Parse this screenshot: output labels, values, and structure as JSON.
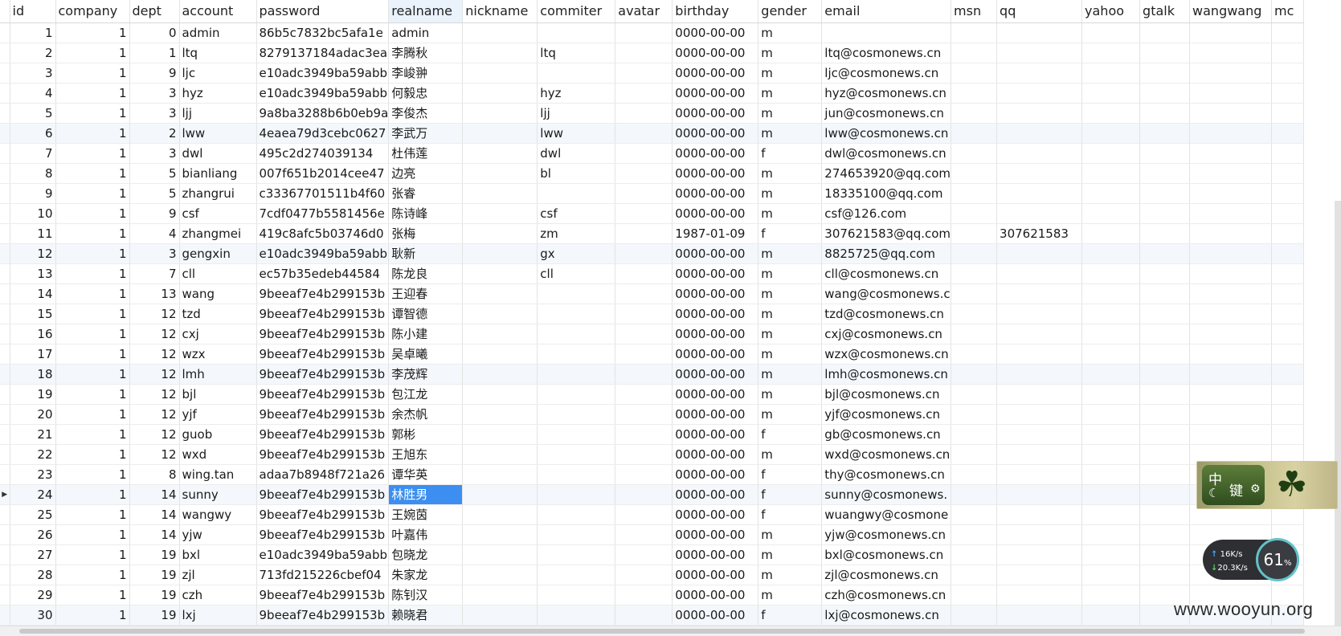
{
  "columns": [
    "id",
    "company",
    "dept",
    "account",
    "password",
    "realname",
    "nickname",
    "commiter",
    "avatar",
    "birthday",
    "gender",
    "email",
    "msn",
    "qq",
    "yahoo",
    "gtalk",
    "wangwang",
    "mc"
  ],
  "rows": [
    [
      "1",
      "1",
      "0",
      "admin",
      "86b5c7832bc5afa1e",
      "admin",
      "",
      "",
      "",
      "0000-00-00",
      "m",
      "",
      "",
      "",
      "",
      "",
      "",
      ""
    ],
    [
      "2",
      "1",
      "1",
      "ltq",
      "8279137184adac3ea",
      "李腾秋",
      "",
      "ltq",
      "",
      "0000-00-00",
      "m",
      "ltq@cosmonews.cn",
      "",
      "",
      "",
      "",
      "",
      ""
    ],
    [
      "3",
      "1",
      "9",
      "ljc",
      "e10adc3949ba59abb",
      "李峻翀",
      "",
      "",
      "",
      "0000-00-00",
      "m",
      "ljc@cosmonews.cn",
      "",
      "",
      "",
      "",
      "",
      ""
    ],
    [
      "4",
      "1",
      "3",
      "hyz",
      "e10adc3949ba59abb",
      "何毅忠",
      "",
      "hyz",
      "",
      "0000-00-00",
      "m",
      "hyz@cosmonews.cn",
      "",
      "",
      "",
      "",
      "",
      ""
    ],
    [
      "5",
      "1",
      "3",
      "ljj",
      "9a8ba3288b6b0eb9a",
      "李俊杰",
      "",
      "ljj",
      "",
      "0000-00-00",
      "m",
      "jun@cosmonews.cn",
      "",
      "",
      "",
      "",
      "",
      ""
    ],
    [
      "6",
      "1",
      "2",
      "lww",
      "4eaea79d3cebc0627",
      "李武万",
      "",
      "lww",
      "",
      "0000-00-00",
      "m",
      "lww@cosmonews.cn",
      "",
      "",
      "",
      "",
      "",
      ""
    ],
    [
      "7",
      "1",
      "3",
      "dwl",
      "495c2d274039134",
      "杜伟莲",
      "",
      "dwl",
      "",
      "0000-00-00",
      "f",
      "dwl@cosmonews.cn",
      "",
      "",
      "",
      "",
      "",
      ""
    ],
    [
      "8",
      "1",
      "5",
      "bianliang",
      "007f651b2014cee47",
      "边亮",
      "",
      "bl",
      "",
      "0000-00-00",
      "m",
      "274653920@qq.com",
      "",
      "",
      "",
      "",
      "",
      ""
    ],
    [
      "9",
      "1",
      "5",
      "zhangrui",
      "c33367701511b4f60",
      "张睿",
      "",
      "",
      "",
      "0000-00-00",
      "m",
      "18335100@qq.com",
      "",
      "",
      "",
      "",
      "",
      ""
    ],
    [
      "10",
      "1",
      "9",
      "csf",
      "7cdf0477b5581456e",
      "陈诗峰",
      "",
      "csf",
      "",
      "0000-00-00",
      "m",
      "csf@126.com",
      "",
      "",
      "",
      "",
      "",
      ""
    ],
    [
      "11",
      "1",
      "4",
      "zhangmei",
      "419c8afc5b03746d0",
      "张梅",
      "",
      "zm",
      "",
      "1987-01-09",
      "f",
      "307621583@qq.com",
      "",
      "307621583",
      "",
      "",
      "",
      ""
    ],
    [
      "12",
      "1",
      "3",
      "gengxin",
      "e10adc3949ba59abb",
      "耿新",
      "",
      "gx",
      "",
      "0000-00-00",
      "m",
      "8825725@qq.com",
      "",
      "",
      "",
      "",
      "",
      ""
    ],
    [
      "13",
      "1",
      "7",
      "cll",
      "ec57b35edeb44584",
      "陈龙良",
      "",
      "cll",
      "",
      "0000-00-00",
      "m",
      "cll@cosmonews.cn",
      "",
      "",
      "",
      "",
      "",
      ""
    ],
    [
      "14",
      "1",
      "13",
      "wang",
      "9beeaf7e4b299153b",
      "王迎春",
      "",
      "",
      "",
      "0000-00-00",
      "m",
      "wang@cosmonews.c",
      "",
      "",
      "",
      "",
      "",
      ""
    ],
    [
      "15",
      "1",
      "12",
      "tzd",
      "9beeaf7e4b299153b",
      "谭智德",
      "",
      "",
      "",
      "0000-00-00",
      "m",
      "tzd@cosmonews.cn",
      "",
      "",
      "",
      "",
      "",
      ""
    ],
    [
      "16",
      "1",
      "12",
      "cxj",
      "9beeaf7e4b299153b",
      "陈小建",
      "",
      "",
      "",
      "0000-00-00",
      "m",
      "cxj@cosmonews.cn",
      "",
      "",
      "",
      "",
      "",
      ""
    ],
    [
      "17",
      "1",
      "12",
      "wzx",
      "9beeaf7e4b299153b",
      "吴卓曦",
      "",
      "",
      "",
      "0000-00-00",
      "m",
      "wzx@cosmonews.cn",
      "",
      "",
      "",
      "",
      "",
      ""
    ],
    [
      "18",
      "1",
      "12",
      "lmh",
      "9beeaf7e4b299153b",
      "李茂辉",
      "",
      "",
      "",
      "0000-00-00",
      "m",
      "lmh@cosmonews.cn",
      "",
      "",
      "",
      "",
      "",
      ""
    ],
    [
      "19",
      "1",
      "12",
      "bjl",
      "9beeaf7e4b299153b",
      "包江龙",
      "",
      "",
      "",
      "0000-00-00",
      "m",
      "bjl@cosmonews.cn",
      "",
      "",
      "",
      "",
      "",
      ""
    ],
    [
      "20",
      "1",
      "12",
      "yjf",
      "9beeaf7e4b299153b",
      "余杰帆",
      "",
      "",
      "",
      "0000-00-00",
      "m",
      "yjf@cosmonews.cn",
      "",
      "",
      "",
      "",
      "",
      ""
    ],
    [
      "21",
      "1",
      "12",
      "guob",
      "9beeaf7e4b299153b",
      "郭彬",
      "",
      "",
      "",
      "0000-00-00",
      "f",
      "gb@cosmonews.cn",
      "",
      "",
      "",
      "",
      "",
      ""
    ],
    [
      "22",
      "1",
      "12",
      "wxd",
      "9beeaf7e4b299153b",
      "王旭东",
      "",
      "",
      "",
      "0000-00-00",
      "m",
      "wxd@cosmonews.cn",
      "",
      "",
      "",
      "",
      "",
      ""
    ],
    [
      "23",
      "1",
      "8",
      "wing.tan",
      "adaa7b8948f721a26",
      "谭华英",
      "",
      "",
      "",
      "0000-00-00",
      "f",
      "thy@cosmonews.cn",
      "",
      "",
      "",
      "",
      "",
      ""
    ],
    [
      "24",
      "1",
      "14",
      "sunny",
      "9beeaf7e4b299153b",
      "林胜男",
      "",
      "",
      "",
      "0000-00-00",
      "f",
      "sunny@cosmonews.",
      "",
      "",
      "",
      "",
      "",
      ""
    ],
    [
      "25",
      "1",
      "14",
      "wangwy",
      "9beeaf7e4b299153b",
      "王婉茵",
      "",
      "",
      "",
      "0000-00-00",
      "f",
      "wuangwy@cosmone",
      "",
      "",
      "",
      "",
      "",
      ""
    ],
    [
      "26",
      "1",
      "14",
      "yjw",
      "9beeaf7e4b299153b",
      "叶嘉伟",
      "",
      "",
      "",
      "0000-00-00",
      "m",
      "yjw@cosmonews.cn",
      "",
      "",
      "",
      "",
      "",
      ""
    ],
    [
      "27",
      "1",
      "19",
      "bxl",
      "e10adc3949ba59abb",
      "包晓龙",
      "",
      "",
      "",
      "0000-00-00",
      "m",
      "bxl@cosmonews.cn",
      "",
      "",
      "",
      "",
      "",
      ""
    ],
    [
      "28",
      "1",
      "19",
      "zjl",
      "713fd215226cbef04",
      "朱家龙",
      "",
      "",
      "",
      "0000-00-00",
      "m",
      "zjl@cosmonews.cn",
      "",
      "",
      "",
      "",
      "",
      ""
    ],
    [
      "29",
      "1",
      "19",
      "czh",
      "9beeaf7e4b299153b",
      "陈钊汉",
      "",
      "",
      "",
      "0000-00-00",
      "m",
      "czh@cosmonews.cn",
      "",
      "",
      "",
      "",
      "",
      ""
    ],
    [
      "30",
      "1",
      "19",
      "lxj",
      "9beeaf7e4b299153b",
      "赖晓君",
      "",
      "",
      "",
      "0000-00-00",
      "f",
      "lxj@cosmonews.cn",
      "",
      "",
      "",
      "",
      "",
      ""
    ]
  ],
  "selection": {
    "row": 24,
    "column": "realname"
  },
  "ime": {
    "lang": "中",
    "mode": "键",
    "gear_icon": "gear-icon",
    "moon_icon": "moon-icon",
    "clover_icon": "clover-icon"
  },
  "network": {
    "up": "16",
    "down": "20.3",
    "unit": "K/s",
    "percent": "61",
    "percent_sign": "%"
  },
  "watermark": "www.wooyun.org",
  "colors": {
    "selection": "#3c8ff0",
    "alt_row": "#f4f8fd"
  }
}
